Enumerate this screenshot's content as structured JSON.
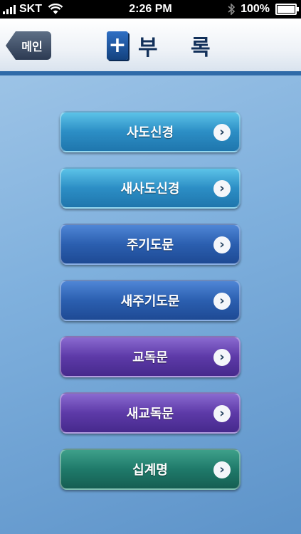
{
  "status_bar": {
    "carrier": "SKT",
    "time": "2:26 PM",
    "battery": "100%",
    "signal_icon": "signal-bars-icon",
    "wifi_icon": "wifi-icon",
    "bluetooth_icon": "bluetooth-icon",
    "battery_icon": "battery-icon"
  },
  "navbar": {
    "back_label": "메인",
    "title": "부 록",
    "title_icon": "book-plus-icon"
  },
  "menu": {
    "items": [
      {
        "label": "사도신경",
        "color": "#2c8ec5"
      },
      {
        "label": "새사도신경",
        "color": "#2c8ec5"
      },
      {
        "label": "주기도문",
        "color": "#2b5fb0"
      },
      {
        "label": "새주기도문",
        "color": "#2b5fb0"
      },
      {
        "label": "교독문",
        "color": "#5d3aa8"
      },
      {
        "label": "새교독문",
        "color": "#5d3aa8"
      },
      {
        "label": "십계명",
        "color": "#1f7a6a"
      }
    ],
    "chevron_icon": "chevron-right-icon",
    "chevron_glyph": "›"
  }
}
